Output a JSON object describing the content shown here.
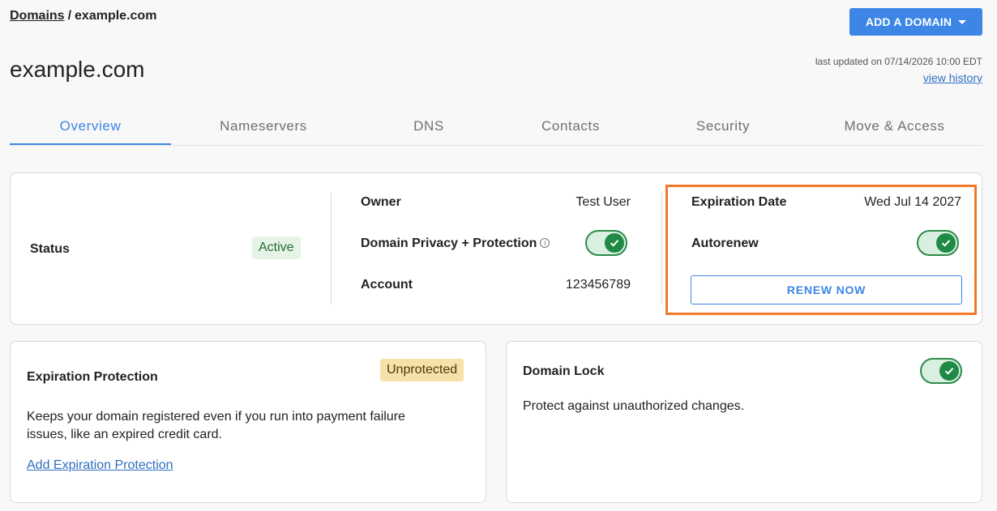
{
  "breadcrumb": {
    "root": "Domains",
    "separator": "/",
    "current": "example.com"
  },
  "header": {
    "add_domain_label": "ADD A DOMAIN",
    "title": "example.com",
    "last_updated": "last updated on 07/14/2026 10:00 EDT",
    "view_history": "view history"
  },
  "tabs": [
    {
      "label": "Overview",
      "active": true
    },
    {
      "label": "Nameservers",
      "active": false
    },
    {
      "label": "DNS",
      "active": false
    },
    {
      "label": "Contacts",
      "active": false
    },
    {
      "label": "Security",
      "active": false
    },
    {
      "label": "Move & Access",
      "active": false
    }
  ],
  "status": {
    "label": "Status",
    "value": "Active",
    "owner_label": "Owner",
    "owner_value": "Test User",
    "privacy_label": "Domain Privacy + Protection",
    "privacy_enabled": true,
    "account_label": "Account",
    "account_value": "123456789",
    "expiration_label": "Expiration Date",
    "expiration_value": "Wed Jul 14 2027",
    "autorenew_label": "Autorenew",
    "autorenew_enabled": true,
    "renew_label": "RENEW NOW"
  },
  "expiration_protection": {
    "title": "Expiration Protection",
    "badge": "Unprotected",
    "description": "Keeps your domain registered even if you run into payment failure issues, like an expired credit card.",
    "link": "Add Expiration Protection"
  },
  "domain_lock": {
    "title": "Domain Lock",
    "description": "Protect against unauthorized changes.",
    "enabled": true
  },
  "colors": {
    "accent": "#3d86e6",
    "highlight": "#f07a2a",
    "toggle_on": "#1f8a44",
    "active_badge_bg": "#e6f4e8",
    "unprotected_badge_bg": "#f6e1a8"
  },
  "icons": {
    "caret": "chevron-down-icon",
    "info": "info-icon",
    "check": "check-icon"
  }
}
